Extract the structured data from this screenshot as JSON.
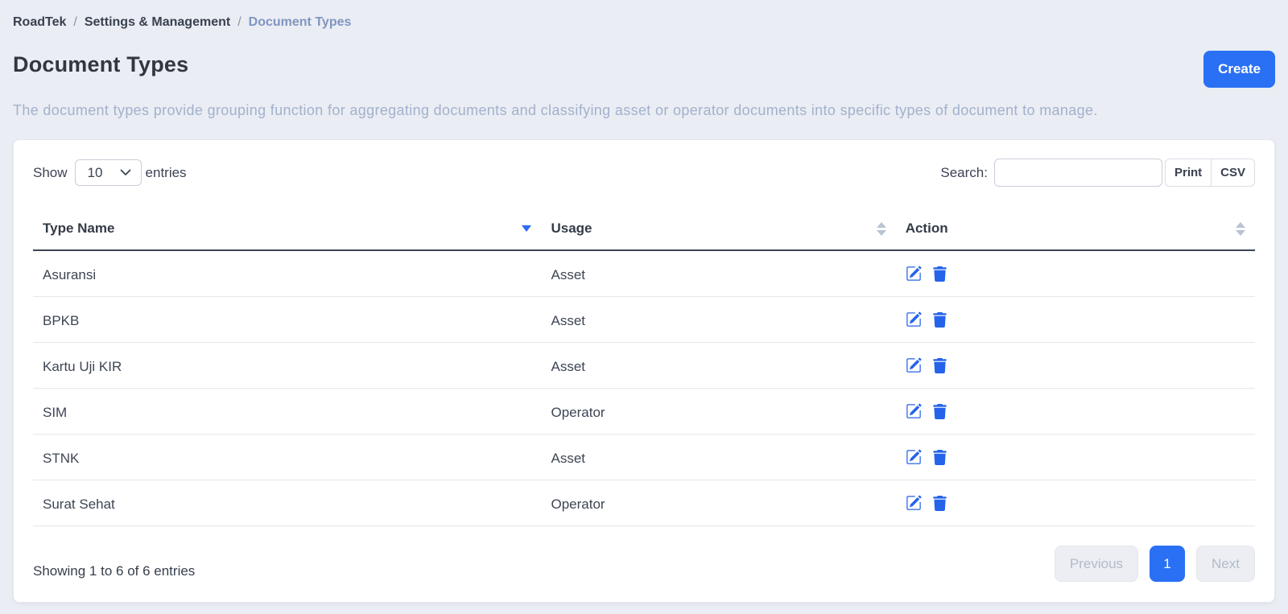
{
  "colors": {
    "accent": "#2a70f4",
    "icon-blue": "#2563eb",
    "bg": "#eaedf4",
    "muted": "#a3b1cc"
  },
  "breadcrumb": {
    "separator": "/",
    "items": [
      {
        "label": "RoadTek"
      },
      {
        "label": "Settings & Management"
      },
      {
        "label": "Document Types"
      }
    ]
  },
  "page": {
    "title": "Document Types",
    "create_label": "Create",
    "description": "The document types provide grouping function for aggregating documents and classifying asset or operator documents into specific types of document to manage."
  },
  "table_controls": {
    "show_label": "Show",
    "page_size": "10",
    "entries_label": "entries",
    "search_label": "Search:",
    "search_value": "",
    "buttons": [
      "Print",
      "CSV"
    ]
  },
  "table": {
    "columns": [
      {
        "label": "Type Name",
        "sort": "descending"
      },
      {
        "label": "Usage",
        "sort": "none"
      },
      {
        "label": "Action",
        "sort": "none"
      }
    ],
    "rows": [
      {
        "type_name": "Asuransi",
        "usage": "Asset"
      },
      {
        "type_name": "BPKB",
        "usage": "Asset"
      },
      {
        "type_name": "Kartu Uji KIR",
        "usage": "Asset"
      },
      {
        "type_name": "SIM",
        "usage": "Operator"
      },
      {
        "type_name": "STNK",
        "usage": "Asset"
      },
      {
        "type_name": "Surat Sehat",
        "usage": "Operator"
      }
    ],
    "action_icons": [
      "pencil-square",
      "trash"
    ]
  },
  "footer": {
    "info": "Showing 1 to 6 of 6 entries",
    "previous_label": "Previous",
    "pages": [
      "1"
    ],
    "active_page": "1",
    "next_label": "Next"
  }
}
